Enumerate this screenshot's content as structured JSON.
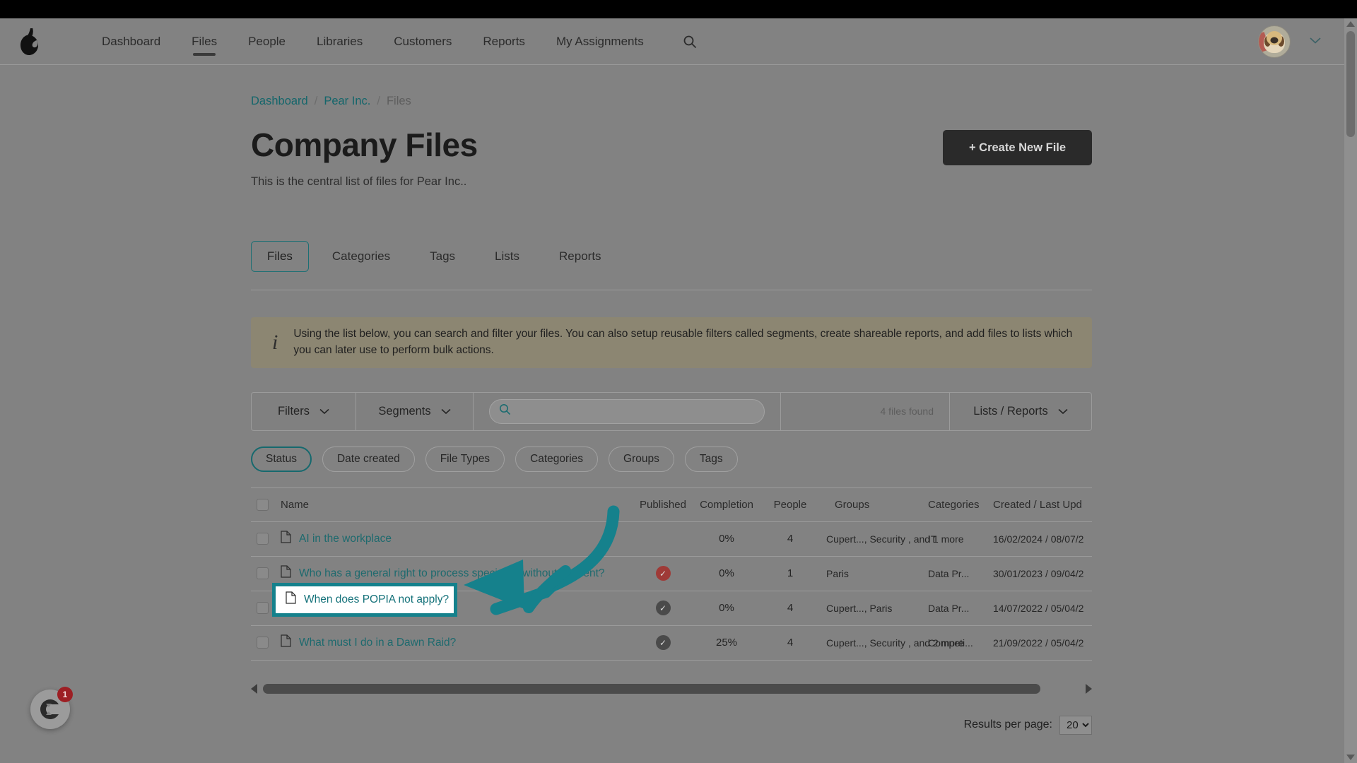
{
  "header": {
    "logo_icon": "pear-logo-icon",
    "nav": [
      {
        "label": "Dashboard",
        "active": false
      },
      {
        "label": "Files",
        "active": true
      },
      {
        "label": "People",
        "active": false
      },
      {
        "label": "Libraries",
        "active": false
      },
      {
        "label": "Customers",
        "active": false
      },
      {
        "label": "Reports",
        "active": false
      },
      {
        "label": "My Assignments",
        "active": false
      }
    ],
    "search_icon": "search-icon",
    "avatar_alt": "user-avatar",
    "account_chevron": "chevron-down-icon"
  },
  "breadcrumb": {
    "items": [
      "Dashboard",
      "Pear Inc.",
      "Files"
    ],
    "separator": "/"
  },
  "page": {
    "title": "Company Files",
    "subtitle": "This is the central list of files for Pear Inc..",
    "create_button": "+ Create New File"
  },
  "tabs": [
    {
      "label": "Files",
      "active": true
    },
    {
      "label": "Categories",
      "active": false
    },
    {
      "label": "Tags",
      "active": false
    },
    {
      "label": "Lists",
      "active": false
    },
    {
      "label": "Reports",
      "active": false
    }
  ],
  "banner": {
    "icon": "info-icon",
    "text": "Using the list below, you can search and filter your files. You can also setup reusable filters called segments, create shareable reports, and add files to lists which you can later use to perform bulk actions."
  },
  "toolbar": {
    "filters_label": "Filters",
    "segments_label": "Segments",
    "search_value": "",
    "search_placeholder": "",
    "results_count": "4 files found",
    "lists_reports_label": "Lists / Reports",
    "chevron": "chevron-down-icon"
  },
  "filter_chips": [
    {
      "label": "Status",
      "active": true
    },
    {
      "label": "Date created",
      "active": false
    },
    {
      "label": "File Types",
      "active": false
    },
    {
      "label": "Categories",
      "active": false
    },
    {
      "label": "Groups",
      "active": false
    },
    {
      "label": "Tags",
      "active": false
    }
  ],
  "table": {
    "columns": [
      "Name",
      "Published",
      "Completion",
      "People",
      "Groups",
      "Categories",
      "Created / Last Upd"
    ],
    "rows": [
      {
        "name": "AI in the workplace",
        "published": "",
        "published_state": "none",
        "completion": "0%",
        "people": "4",
        "groups": "Cupert..., Security , and 1 more",
        "categories": "IT",
        "dates": "16/02/2024 / 08/07/2",
        "highlighted": false
      },
      {
        "name": "Who has a general right to process special PI without consent?",
        "published": "✓",
        "published_state": "red",
        "completion": "0%",
        "people": "1",
        "groups": "Paris",
        "categories": "Data Pr...",
        "dates": "30/01/2023 / 09/04/2",
        "highlighted": false
      },
      {
        "name": "When does POPIA not apply?",
        "published": "✓",
        "published_state": "dark",
        "completion": "0%",
        "people": "4",
        "groups": "Cupert..., Paris",
        "categories": "Data Pr...",
        "dates": "14/07/2022 / 05/04/2",
        "highlighted": true
      },
      {
        "name": "What must I do in a Dawn Raid?",
        "published": "✓",
        "published_state": "dark",
        "completion": "25%",
        "people": "4",
        "groups": "Cupert..., Security , and 2 more",
        "categories": "Competi...",
        "dates": "21/09/2022 / 05/04/2",
        "highlighted": false
      }
    ]
  },
  "pagination": {
    "results_per_page_label": "Results per page:",
    "results_per_page_value": "20",
    "options": [
      "20"
    ]
  },
  "chat_widget": {
    "icon": "chat-bubble-icon",
    "badge": "1"
  },
  "colors": {
    "accent_teal": "#15818c",
    "link_teal": "#1e6a6e",
    "banner_bg": "#8c8672",
    "dark_button": "#2a2a2a",
    "published_red": "#9f3a37",
    "published_dark": "#4a4a4a",
    "badge_red": "#9d1f24"
  }
}
